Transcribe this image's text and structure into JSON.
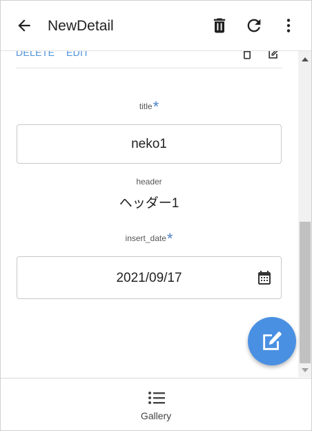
{
  "appbar": {
    "title": "NewDetail",
    "back_icon": "arrow-left-icon",
    "delete_icon": "trash-icon",
    "refresh_icon": "refresh-icon",
    "more_icon": "more-vertical-icon"
  },
  "actions": {
    "delete_label": "DELETE",
    "edit_label": "EDIT",
    "delete_icon": "trash-outline-icon",
    "edit_icon": "edit-icon"
  },
  "fields": {
    "title": {
      "label": "title",
      "required_mark": "*",
      "value": "neko1"
    },
    "header": {
      "label": "header",
      "value": "ヘッダー1"
    },
    "insert_date": {
      "label": "insert_date",
      "required_mark": "*",
      "value": "2021/09/17",
      "icon": "calendar-icon"
    }
  },
  "fab": {
    "icon": "edit-icon"
  },
  "bottom_nav": {
    "items": [
      {
        "label": "Gallery",
        "icon": "list-icon"
      }
    ]
  },
  "colors": {
    "accent": "#4a90e2",
    "link": "#4a90d9",
    "required": "#4a7fc4"
  }
}
